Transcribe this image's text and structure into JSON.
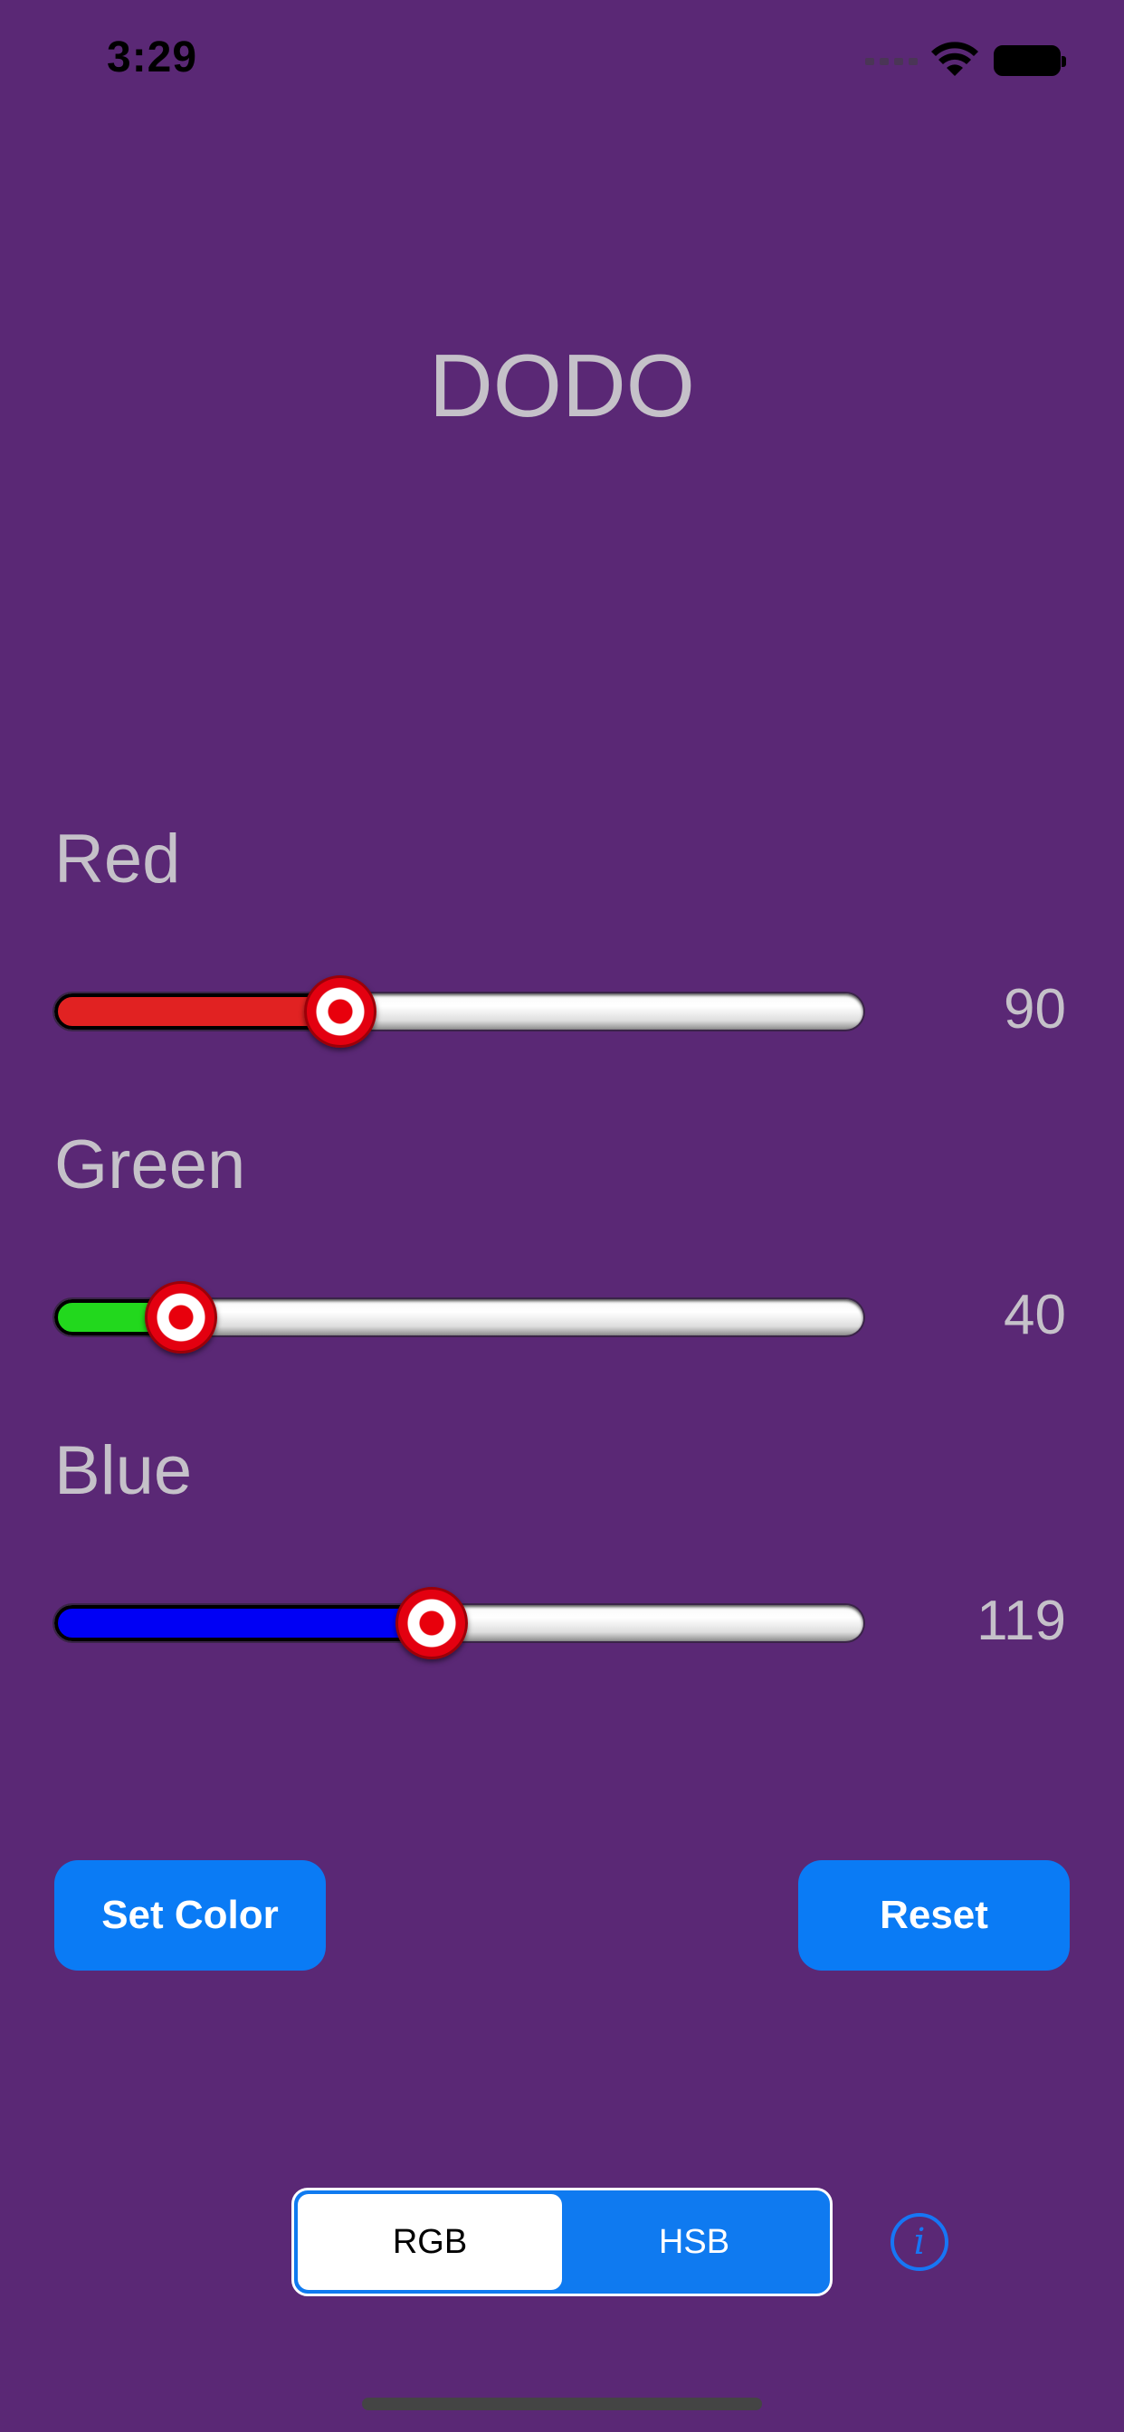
{
  "status_bar": {
    "time": "3:29"
  },
  "title": "DODO",
  "sliders": [
    {
      "label": "Red",
      "value": "90",
      "fraction": 0.353,
      "fill_color": "#e12222"
    },
    {
      "label": "Green",
      "value": "40",
      "fraction": 0.157,
      "fill_color": "#22d81d"
    },
    {
      "label": "Blue",
      "value": "119",
      "fraction": 0.467,
      "fill_color": "#0000f5"
    }
  ],
  "buttons": {
    "set_color": "Set Color",
    "reset": "Reset"
  },
  "segmented_control": {
    "options": [
      "RGB",
      "HSB"
    ],
    "selected": "RGB"
  },
  "icons": {
    "info": "info-icon",
    "wifi": "wifi-icon",
    "battery": "battery-icon"
  },
  "colors": {
    "background": "#5a2875",
    "accent": "#0a7bf5",
    "thumb": "#e30010"
  }
}
